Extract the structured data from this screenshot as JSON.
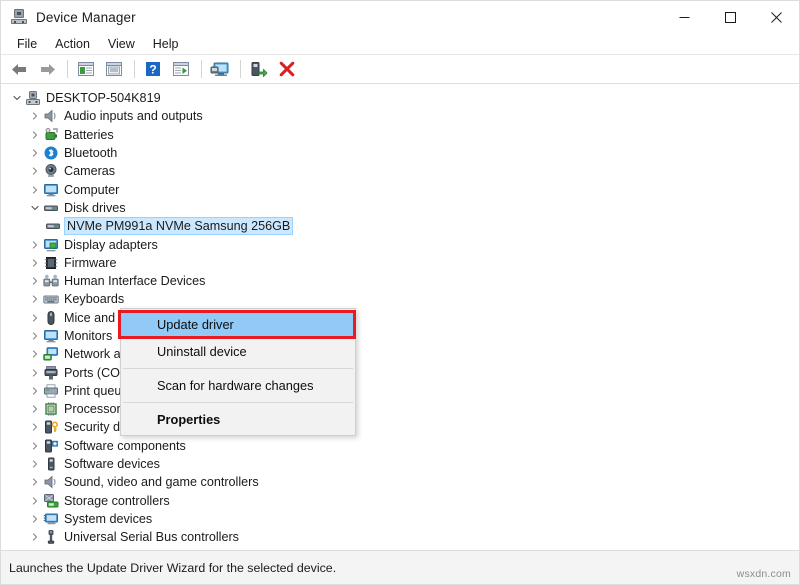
{
  "window": {
    "title": "Device Manager",
    "icon": "device-manager-icon",
    "controls": {
      "minimize": "–",
      "maximize": "□",
      "close": "✕"
    }
  },
  "menubar": {
    "items": [
      {
        "label": "File"
      },
      {
        "label": "Action"
      },
      {
        "label": "View"
      },
      {
        "label": "Help"
      }
    ]
  },
  "toolbar": {
    "buttons": [
      {
        "name": "back-icon"
      },
      {
        "name": "forward-icon"
      },
      {
        "name": "separator"
      },
      {
        "name": "properties-icon"
      },
      {
        "name": "show-hidden-devices-icon"
      },
      {
        "name": "separator"
      },
      {
        "name": "help-icon"
      },
      {
        "name": "update-driver-icon"
      },
      {
        "name": "separator"
      },
      {
        "name": "scan-hardware-changes-icon"
      },
      {
        "name": "separator"
      },
      {
        "name": "enable-device-icon"
      },
      {
        "name": "uninstall-device-icon"
      }
    ]
  },
  "tree": {
    "root": {
      "label": "DESKTOP-504K819",
      "icon": "computer-root-icon",
      "expanded": true
    },
    "items": [
      {
        "label": "Audio inputs and outputs",
        "icon": "speaker-icon",
        "expanded": false,
        "selected": false
      },
      {
        "label": "Batteries",
        "icon": "battery-icon",
        "expanded": false,
        "selected": false
      },
      {
        "label": "Bluetooth",
        "icon": "bluetooth-icon",
        "expanded": false,
        "selected": false
      },
      {
        "label": "Cameras",
        "icon": "camera-icon",
        "expanded": false,
        "selected": false
      },
      {
        "label": "Computer",
        "icon": "monitor-icon",
        "expanded": false,
        "selected": false
      },
      {
        "label": "Disk drives",
        "icon": "disk-drive-icon",
        "expanded": true,
        "selected": false
      },
      {
        "label": "NVMe PM991a NVMe Samsung 256GB",
        "icon": "disk-drive-icon",
        "child": true,
        "selected": true
      },
      {
        "label": "Display adapters",
        "icon": "display-adapter-icon",
        "expanded": false,
        "selected": false
      },
      {
        "label": "Firmware",
        "icon": "firmware-icon",
        "expanded": false,
        "selected": false
      },
      {
        "label": "Human Interface Devices",
        "icon": "hid-icon",
        "expanded": false,
        "selected": false
      },
      {
        "label": "Keyboards",
        "icon": "keyboard-icon",
        "expanded": false,
        "selected": false
      },
      {
        "label": "Mice and other pointing devices",
        "icon": "mouse-icon",
        "expanded": false,
        "selected": false
      },
      {
        "label": "Monitors",
        "icon": "monitor-icon",
        "expanded": false,
        "selected": false
      },
      {
        "label": "Network adapters",
        "icon": "network-adapter-icon",
        "expanded": false,
        "selected": false
      },
      {
        "label": "Ports (COM & LPT)",
        "icon": "port-icon",
        "expanded": false,
        "selected": false
      },
      {
        "label": "Print queues",
        "icon": "printer-icon",
        "expanded": false,
        "selected": false
      },
      {
        "label": "Processors",
        "icon": "processor-icon",
        "expanded": false,
        "selected": false
      },
      {
        "label": "Security devices",
        "icon": "security-device-icon",
        "expanded": false,
        "selected": false
      },
      {
        "label": "Software components",
        "icon": "software-component-icon",
        "expanded": false,
        "selected": false
      },
      {
        "label": "Software devices",
        "icon": "software-device-icon",
        "expanded": false,
        "selected": false
      },
      {
        "label": "Sound, video and game controllers",
        "icon": "speaker-icon",
        "expanded": false,
        "selected": false
      },
      {
        "label": "Storage controllers",
        "icon": "storage-controller-icon",
        "expanded": false,
        "selected": false
      },
      {
        "label": "System devices",
        "icon": "system-device-icon",
        "expanded": false,
        "selected": false
      },
      {
        "label": "Universal Serial Bus controllers",
        "icon": "usb-icon",
        "expanded": false,
        "selected": false
      }
    ]
  },
  "context_menu": {
    "items": [
      {
        "label": "Update driver",
        "highlighted": true,
        "bold": false
      },
      {
        "label": "Uninstall device",
        "highlighted": false,
        "bold": false
      },
      {
        "label": "Scan for hardware changes",
        "highlighted": false,
        "bold": false
      },
      {
        "label": "Properties",
        "highlighted": false,
        "bold": true
      }
    ]
  },
  "statusbar": {
    "text": "Launches the Update Driver Wizard for the selected device."
  },
  "watermark": {
    "text": "wsxdn.com"
  },
  "colors": {
    "highlight_blue": "#91c9f7",
    "selection_blue": "#cce8ff",
    "annotation_red": "#e81b23"
  }
}
